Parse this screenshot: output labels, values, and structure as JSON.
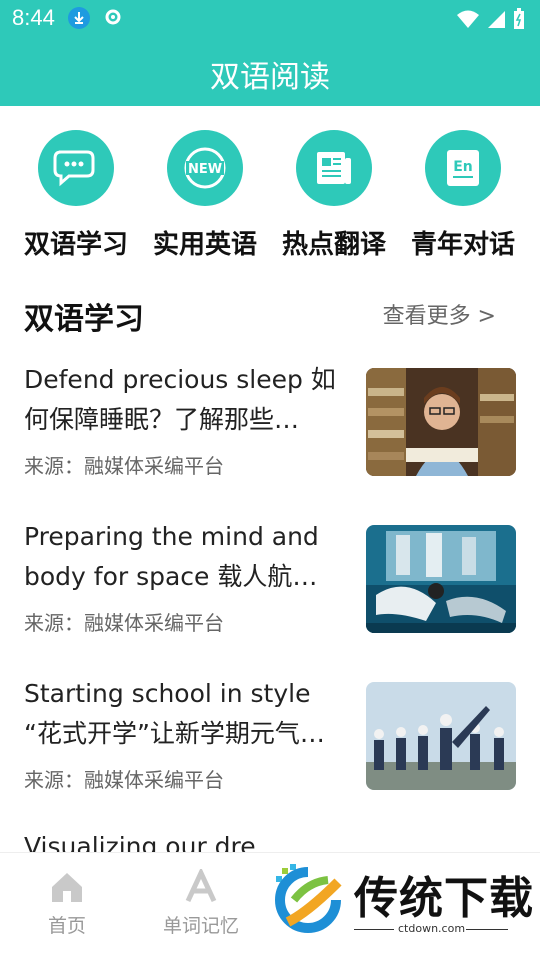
{
  "status_bar": {
    "time": "8:44"
  },
  "app_bar": {
    "title": "双语阅读"
  },
  "categories": [
    {
      "label": "双语学习",
      "icon": "chat-bubbles-icon"
    },
    {
      "label": "实用英语",
      "icon": "new-badge-icon"
    },
    {
      "label": "热点翻译",
      "icon": "newspaper-icon"
    },
    {
      "label": "青年对话",
      "icon": "en-card-icon"
    }
  ],
  "section": {
    "title": "双语学习",
    "more_label": "查看更多 >"
  },
  "articles": [
    {
      "title": "Defend precious sleep 如何保障睡眠？了解那些…",
      "source": "来源：融媒体采编平台"
    },
    {
      "title": "Preparing the mind and body for space 载人航…",
      "source": "来源：融媒体采编平台"
    },
    {
      "title": "Starting school in style “花式开学”让新学期元气…",
      "source": "来源：融媒体采编平台"
    }
  ],
  "peek_article": {
    "title": "Visualizing our dre"
  },
  "bottom_nav": [
    {
      "label": "首页",
      "icon": "home-icon"
    },
    {
      "label": "单词记忆",
      "icon": "letter-a-icon"
    }
  ],
  "watermark": {
    "brand": "传统下载",
    "url": "ctdown.com"
  },
  "colors": {
    "accent": "#2ec9b9"
  }
}
